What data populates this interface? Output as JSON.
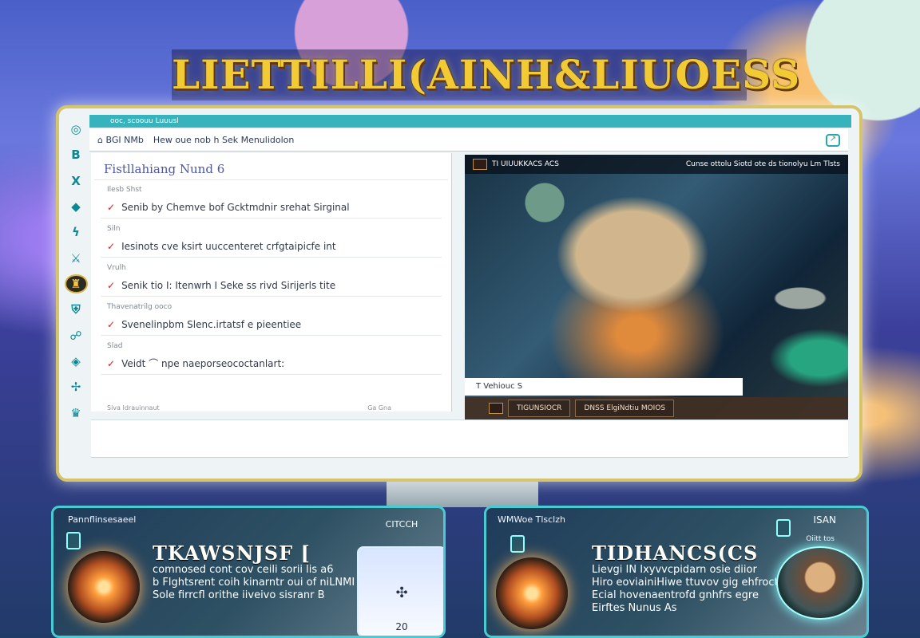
{
  "logo_title": "LIETTILLI(AINH&LIUOESS",
  "browser": {
    "top_strip_text": "ooc, scoouu Luuusl",
    "address_text": "Hew oue nob h Sek Menulidolon",
    "home_label": "⌂ BGI NMb"
  },
  "sidebar": {
    "icons": [
      {
        "name": "target-icon",
        "glyph": "◎"
      },
      {
        "name": "book-icon",
        "glyph": "B"
      },
      {
        "name": "x-icon",
        "glyph": "X"
      },
      {
        "name": "crystal-icon",
        "glyph": "◆"
      },
      {
        "name": "lightning-icon",
        "glyph": "ϟ"
      },
      {
        "name": "sword-icon",
        "glyph": "⚔"
      },
      {
        "name": "crest-icon",
        "glyph": "♜"
      },
      {
        "name": "shield-icon",
        "glyph": "⛨"
      },
      {
        "name": "runner-icon",
        "glyph": "☍"
      },
      {
        "name": "gem-icon",
        "glyph": "◈"
      },
      {
        "name": "shell-icon",
        "glyph": "✢"
      },
      {
        "name": "crown-icon",
        "glyph": "♛"
      }
    ]
  },
  "tasks": {
    "title": "Fistllahiang Nund 6",
    "section_label": "Ilesb Shst",
    "items": [
      {
        "group": "",
        "text": "Senib by Chemve bof Gcktmdnir srehat Sirginal"
      },
      {
        "group": "Siln",
        "text": "Iesinots cve ksirt uuccenteret crfgtaipicfe int"
      },
      {
        "group": "Vrulh",
        "text": "Senik tio I: Itenwrh I Seke ss rivd Sirijerls tite"
      },
      {
        "group": "Thavenatrilg ooco",
        "text": "Svenelinpbm Slenc.irtatsf e pieentiee"
      },
      {
        "group": "Slad",
        "text": "Veidt ⌒ npe naeporseococtanlart:"
      }
    ],
    "footer_left": "Siva Idrauinnaut",
    "footer_right": "Ga  Gna"
  },
  "game": {
    "header_title": "TI UIUUKKACS ACS",
    "header_meta": "Cunse ottolu Siotd ote ds tionolyu Lm Tlsts",
    "caption": "T Vehiouc S",
    "status_left": "TIGUNSIOCR",
    "status_right": "DNSS ElgiNdtiu MOIOS"
  },
  "cards": {
    "left": {
      "label": "Pannflinsesaeel",
      "title": "TKAWSNJSF [",
      "desc": [
        "comnosed cont cov ceili sorii lis a6",
        "b Flghtsrent coih kinarntr oui of niLNMI",
        "Sole firrcfl orithe iiveivo sisranr B"
      ],
      "preview_top": "CITCCH",
      "preview_symbol": "✣",
      "preview_count": "20"
    },
    "right": {
      "label": "WMWoe Tlsclzh",
      "title": "TIDHANCS(CS",
      "desc": [
        "Lievgi IN Ixyvvcpidarn osie diior",
        "Hiro eoviainiHiwe ttuvov gig ehfrocte",
        "Ecial hovenaentrofd gnhfrs egre",
        "Eirftes Nunus As"
      ],
      "meta": "ISAN",
      "submeta": "Oiitt tos"
    }
  },
  "colors": {
    "accent": "#36b3bd",
    "gold": "#f2cb34",
    "check": "#d02323"
  }
}
